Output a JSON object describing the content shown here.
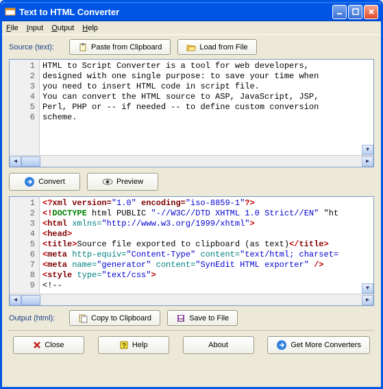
{
  "window": {
    "title": "Text to HTML Converter"
  },
  "menu": {
    "file": "File",
    "input": "Input",
    "output": "Output",
    "help": "Help"
  },
  "source": {
    "label": "Source (text):",
    "paste": "Paste from Clipboard",
    "load": "Load from File",
    "lines": [
      "HTML to Script Converter is a tool for web developers,",
      "designed with one single purpose: to save your time when",
      "you need to insert HTML code in script file.",
      "You can convert the HTML source to ASP, JavaScript, JSP,",
      "Perl, PHP or -- if needed -- to define custom conversion",
      "scheme."
    ]
  },
  "actions": {
    "convert": "Convert",
    "preview": "Preview"
  },
  "output": {
    "label": "Output (html):",
    "copy": "Copy to Clipboard",
    "save": "Save to File"
  },
  "html_lines": {
    "l1_a": "<?",
    "l1_b": "xml version=",
    "l1_c": "\"1.0\"",
    "l1_d": " encoding=",
    "l1_e": "\"iso-8859-1\"",
    "l1_f": "?>",
    "l2_a": "<!",
    "l2_b": "DOCTYPE",
    "l2_c": " html PUBLIC ",
    "l2_d": "\"-//W3C//DTD XHTML 1.0 Strict//EN\"",
    "l2_e": " \"ht",
    "l3_a": "<",
    "l3_b": "html",
    "l3_c": " xmlns=",
    "l3_d": "\"http://www.w3.org/1999/xhtml\"",
    "l3_e": ">",
    "l4_a": "<",
    "l4_b": "head",
    "l4_c": ">",
    "l5_a": "<",
    "l5_b": "title",
    "l5_c": ">",
    "l5_d": "Source file exported to clipboard (as text)",
    "l5_e": "</",
    "l5_f": "title",
    "l5_g": ">",
    "l6_a": "<",
    "l6_b": "meta",
    "l6_c": " http-equiv=",
    "l6_d": "\"Content-Type\"",
    "l6_e": " content=",
    "l6_f": "\"text/html; charset=",
    "l7_a": "<",
    "l7_b": "meta",
    "l7_c": " name=",
    "l7_d": "\"generator\"",
    "l7_e": " content=",
    "l7_f": "\"SynEdit HTML exporter\"",
    "l7_g": " />",
    "l8_a": "<",
    "l8_b": "style",
    "l8_c": " type=",
    "l8_d": "\"text/css\"",
    "l8_e": ">",
    "l9": "<!--"
  },
  "gutter": {
    "n1": "1",
    "n2": "2",
    "n3": "3",
    "n4": "4",
    "n5": "5",
    "n6": "6",
    "n7": "7",
    "n8": "8",
    "n9": "9"
  },
  "footer": {
    "close": "Close",
    "help": "Help",
    "about": "About",
    "more": "Get More Converters"
  }
}
